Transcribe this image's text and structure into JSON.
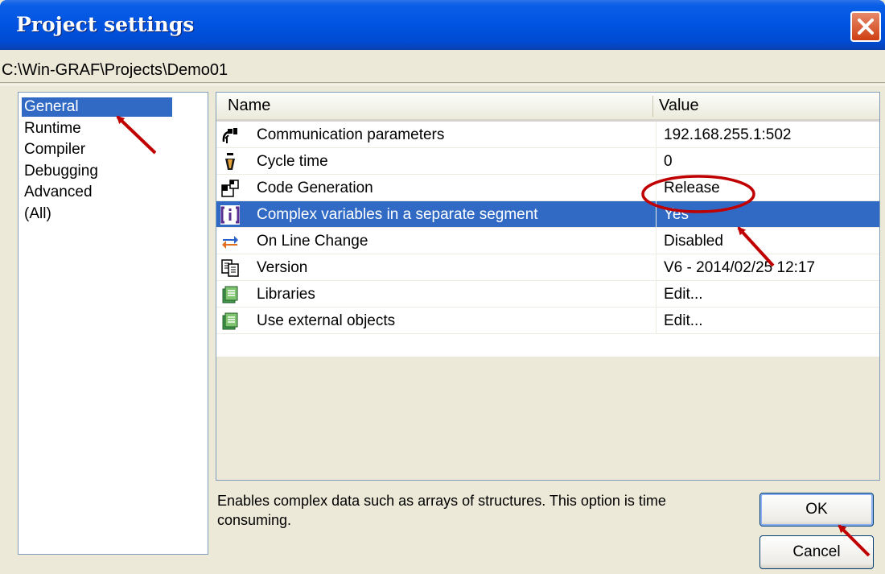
{
  "window": {
    "title": "Project settings",
    "close_icon": "close-icon"
  },
  "path": "C:\\Win-GRAF\\Projects\\Demo01",
  "categories": [
    {
      "label": "General",
      "selected": true
    },
    {
      "label": "Runtime"
    },
    {
      "label": "Compiler"
    },
    {
      "label": "Debugging"
    },
    {
      "label": "Advanced"
    },
    {
      "label": "(All)"
    }
  ],
  "grid": {
    "headers": {
      "name": "Name",
      "value": "Value"
    },
    "rows": [
      {
        "icon": "network-icon",
        "name": "Communication parameters",
        "value": "192.168.255.1:502"
      },
      {
        "icon": "stopwatch-icon",
        "name": "Cycle time",
        "value": "0"
      },
      {
        "icon": "code-generation-icon",
        "name": "Code Generation",
        "value": "Release"
      },
      {
        "icon": "array-brackets-icon",
        "name": "Complex variables in a separate segment",
        "value": "Yes",
        "selected": true
      },
      {
        "icon": "swap-arrows-icon",
        "name": "On Line Change",
        "value": "Disabled"
      },
      {
        "icon": "documents-icon",
        "name": "Version",
        "value": "V6 - 2014/02/25 12:17"
      },
      {
        "icon": "library-icon",
        "name": "Libraries",
        "value": "Edit..."
      },
      {
        "icon": "library-icon",
        "name": "Use external objects",
        "value": "Edit..."
      }
    ]
  },
  "description": "Enables complex data such as arrays of structures. This option is time consuming.",
  "buttons": {
    "ok": "OK",
    "cancel": "Cancel"
  },
  "colors": {
    "title_bar": "#0053e0",
    "selection": "#316ac5",
    "annotation": "#c00000"
  }
}
